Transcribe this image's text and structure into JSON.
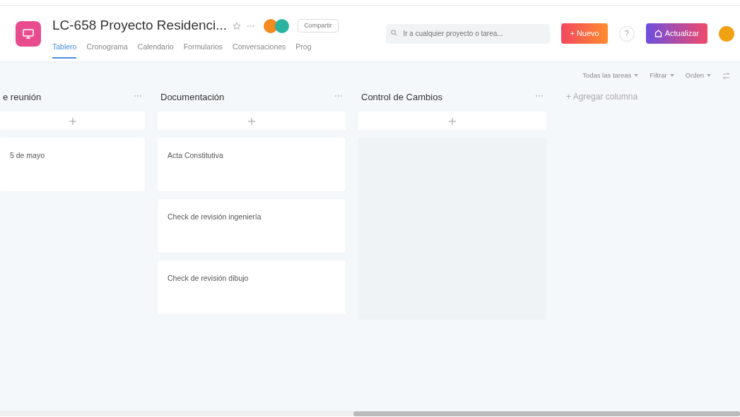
{
  "project": {
    "title": "LC-658 Proyecto Residenci...",
    "favorite": false
  },
  "share_button": "Compartir",
  "tabs": [
    {
      "label": "Tablero",
      "selected": true
    },
    {
      "label": "Cronograma",
      "selected": false
    },
    {
      "label": "Calendario",
      "selected": false
    },
    {
      "label": "Formularios",
      "selected": false
    },
    {
      "label": "Conversaciones",
      "selected": false
    },
    {
      "label": "Prog",
      "selected": false
    }
  ],
  "search": {
    "placeholder": "Ir a cualquier proyecto o tarea..."
  },
  "new_button": "+ Nuevo",
  "help_button": "?",
  "upgrade_button": "Actualizar",
  "toolbar": [
    "Todas las tareas",
    "Filtrar",
    "Orden"
  ],
  "columns": [
    {
      "title": "e reunión",
      "cards": [
        "5 de mayo"
      ]
    },
    {
      "title": "Documentación",
      "cards": [
        "Acta Constitutiva",
        "Check de revisión ingeniería",
        "Check de revisión dibujo"
      ]
    },
    {
      "title": "Control de Cambios"
    }
  ],
  "add_column": "+ Agregar columna"
}
